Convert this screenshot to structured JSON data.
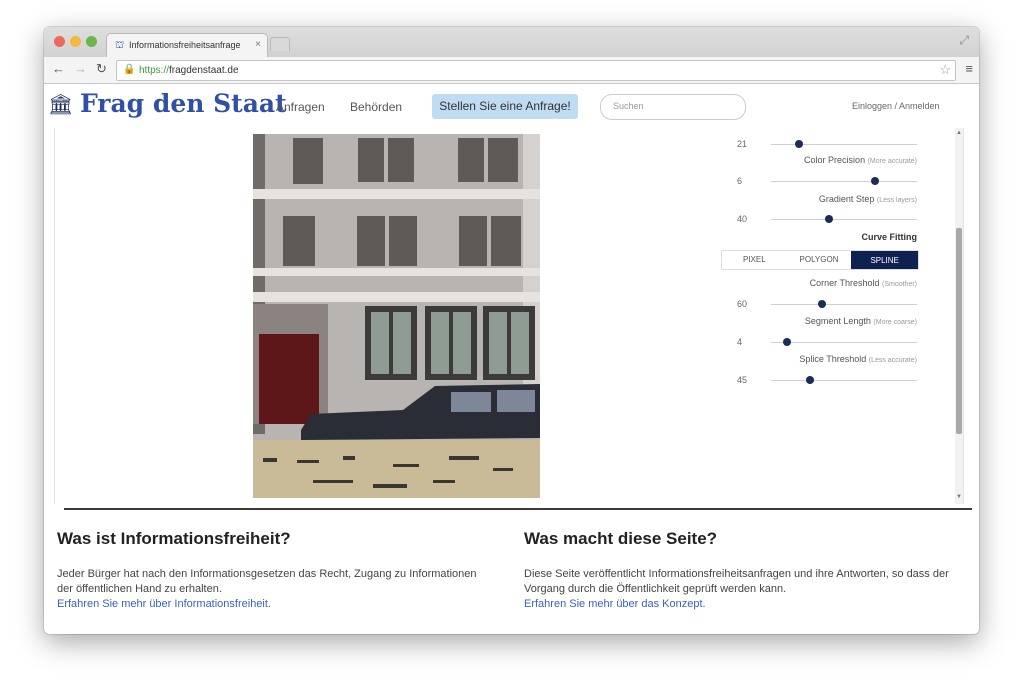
{
  "browser": {
    "tab_title": "Informationsfreiheitsanfrage",
    "url_scheme": "https://",
    "url_rest": "fragdenstaat.de"
  },
  "site": {
    "logo_text": "Frag den Staat",
    "nav": {
      "requests": "Anfragen",
      "authorities": "Behörden",
      "cta": "Stellen Sie eine Anfrage!",
      "search_placeholder": "Suchen",
      "login": "Einloggen / Anmelden"
    }
  },
  "panel": {
    "top_value": "21",
    "color_precision": {
      "label": "Color Precision",
      "hint": "(More accurate)",
      "value": "6",
      "level_percent": 71
    },
    "gradient_step": {
      "label": "Gradient Step",
      "hint": "(Less layers)",
      "value": "40",
      "level_percent": 40
    },
    "top_slider_level_percent": 19,
    "curve_fitting": {
      "heading": "Curve Fitting",
      "modes": [
        "PIXEL",
        "POLYGON",
        "SPLINE"
      ],
      "active": "SPLINE"
    },
    "corner_threshold": {
      "label": "Corner Threshold",
      "hint": "(Smoother)",
      "value": "60",
      "level_percent": 35
    },
    "segment_length": {
      "label": "Segment Length",
      "hint": "(More coarse)",
      "value": "4",
      "level_percent": 11
    },
    "splice_threshold": {
      "label": "Splice Threshold",
      "hint": "(Less accurate)",
      "value": "45",
      "level_percent": 27
    }
  },
  "info": {
    "left": {
      "title": "Was ist Informationsfreiheit?",
      "body": "Jeder Bürger hat nach den Informationsgesetzen das Recht, Zugang zu Informationen der öffentlichen Hand zu erhalten.",
      "link": "Erfahren Sie mehr über Informationsfreiheit."
    },
    "right": {
      "title": "Was macht diese Seite?",
      "body": "Diese Seite veröffentlicht Informationsfreiheitsanfragen und ihre Antworten, so dass der Vorgang durch die Öffentlichkeit geprüft werden kann.",
      "link": "Erfahren Sie mehr über das Konzept."
    }
  }
}
